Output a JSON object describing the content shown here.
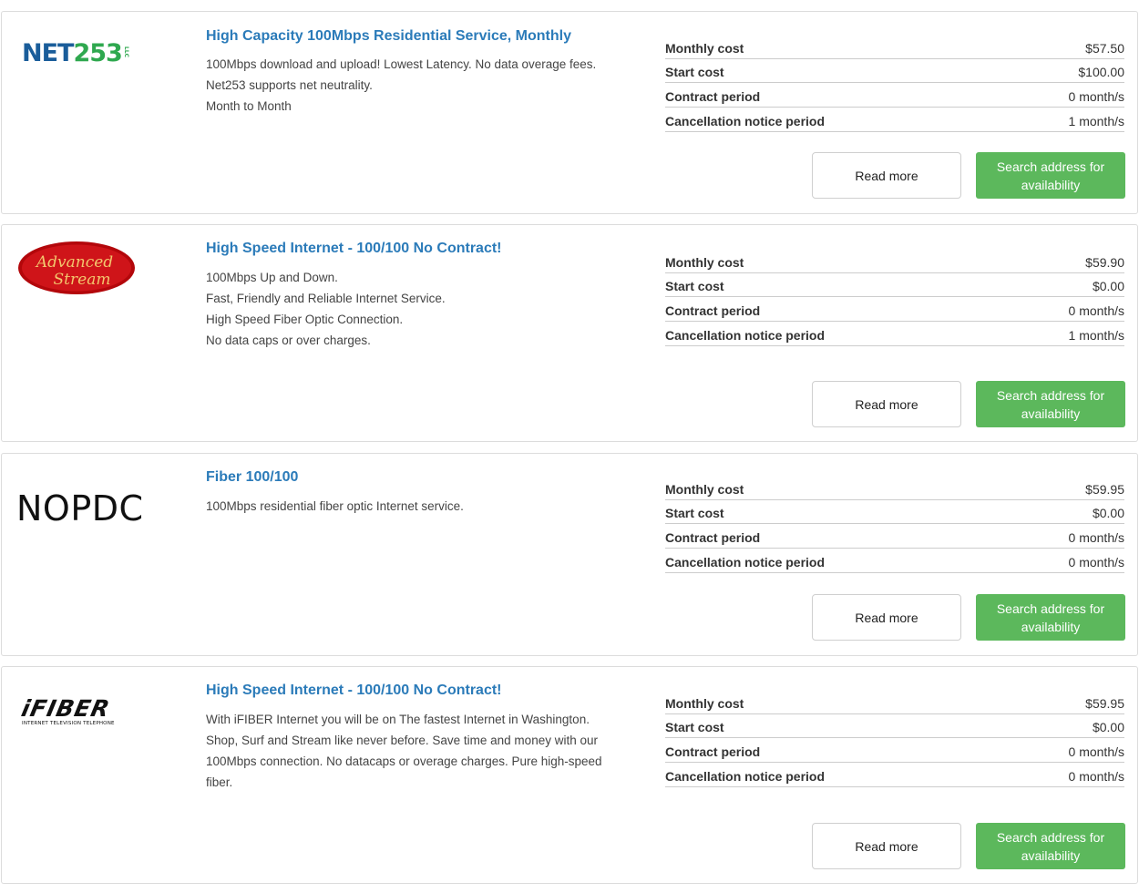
{
  "buttons": {
    "read_more": "Read more",
    "search": "Search address for availability"
  },
  "colors": {
    "title": "#2b7bb9",
    "search_button": "#5cb85c"
  },
  "listings": [
    {
      "logo": {
        "text_a": "NET",
        "text_b": "253",
        "small": "LLC"
      },
      "title": "High Capacity 100Mbps Residential Service, Monthly",
      "description": [
        "100Mbps download and upload! Lowest Latency. No data overage fees.",
        "Net253 supports net neutrality.",
        "Month to Month"
      ],
      "specs": [
        {
          "label": "Monthly cost",
          "value": "$57.50"
        },
        {
          "label": "Start cost",
          "value": "$100.00"
        },
        {
          "label": "Contract period",
          "value": "0 month/s"
        },
        {
          "label": "Cancellation notice period",
          "value": "1 month/s"
        }
      ]
    },
    {
      "logo": {
        "line1": "Advanced",
        "line2": "Stream"
      },
      "title": "High Speed Internet - 100/100 No Contract!",
      "description": [
        "100Mbps Up and Down.",
        "Fast, Friendly and Reliable Internet Service.",
        "High Speed Fiber Optic Connection.",
        "No data caps or over charges."
      ],
      "specs": [
        {
          "label": "Monthly cost",
          "value": "$59.90"
        },
        {
          "label": "Start cost",
          "value": "$0.00"
        },
        {
          "label": "Contract period",
          "value": "0 month/s"
        },
        {
          "label": "Cancellation notice period",
          "value": "1 month/s"
        }
      ]
    },
    {
      "logo": {
        "text": "NOPDC"
      },
      "title": "Fiber 100/100",
      "description": [
        "100Mbps residential fiber optic Internet service."
      ],
      "specs": [
        {
          "label": "Monthly cost",
          "value": "$59.95"
        },
        {
          "label": "Start cost",
          "value": "$0.00"
        },
        {
          "label": "Contract period",
          "value": "0 month/s"
        },
        {
          "label": "Cancellation notice period",
          "value": "0 month/s"
        }
      ]
    },
    {
      "logo": {
        "text": "iFIBER",
        "tagline": "INTERNET TELEVISION TELEPHONE"
      },
      "title": "High Speed Internet - 100/100 No Contract!",
      "description": [
        "With iFIBER Internet you will be on The fastest Internet in Washington.",
        "Shop, Surf and Stream like never before. Save time and money with our",
        "100Mbps connection. No datacaps or overage charges. Pure high-speed",
        "fiber."
      ],
      "specs": [
        {
          "label": "Monthly cost",
          "value": "$59.95"
        },
        {
          "label": "Start cost",
          "value": "$0.00"
        },
        {
          "label": "Contract period",
          "value": "0 month/s"
        },
        {
          "label": "Cancellation notice period",
          "value": "0 month/s"
        }
      ]
    }
  ]
}
